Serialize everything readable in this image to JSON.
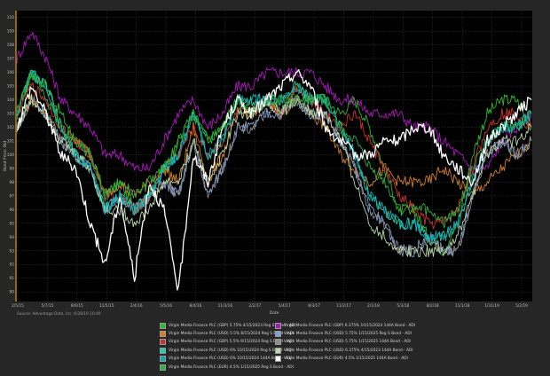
{
  "chart_data": {
    "type": "line",
    "title": "",
    "xlabel": "Date",
    "ylabel": "Bond Price: Bid",
    "source": "Source: Advantage Data, Inc. 6/28/19 10:40",
    "x_ticks": [
      "2/5/15",
      "5/7/15",
      "8/6/15",
      "11/5/15",
      "2/4/16",
      "5/5/16",
      "8/4/16",
      "11/3/16",
      "2/2/17",
      "5/4/17",
      "8/3/17",
      "11/2/17",
      "2/1/18",
      "5/3/18",
      "8/2/18",
      "11/1/18",
      "1/31/19",
      "5/2/19"
    ],
    "y_ticks": [
      90,
      91,
      92,
      93,
      94,
      95,
      96,
      97,
      98,
      99,
      100,
      101,
      102,
      103,
      104,
      105,
      106,
      107,
      108,
      109,
      110
    ],
    "ylim": [
      89.3,
      110.5
    ],
    "grid": true,
    "legend_position": "bottom",
    "colors": {
      "background": "#000000",
      "frame": "#262626",
      "grid": "#3a3a3a",
      "baseline": "#e0a020"
    },
    "series": [
      {
        "name": "Virgin Media Finance PLC (GBP) 5.75% 4/15/2023 Reg S Bond - ADI",
        "color": "#2db82d",
        "values": [
          103,
          106,
          105,
          103,
          101,
          100,
          97,
          98,
          96,
          97,
          99,
          101,
          103,
          101,
          102,
          104,
          103,
          104,
          103,
          105,
          104,
          104,
          103,
          104,
          102,
          99,
          96,
          96,
          94,
          93,
          95,
          100,
          103,
          104,
          104,
          102
        ]
      },
      {
        "name": "Virgin Media Finance PLC (GBP) 6.375% 10/15/2024 144A Bond - ADI",
        "color": "#a818b8",
        "values": [
          107,
          109,
          107,
          104,
          103,
          102,
          100,
          100,
          99,
          99,
          101,
          103,
          104,
          102,
          103,
          105,
          105,
          106,
          106,
          106,
          106,
          105,
          104,
          104,
          103,
          103,
          103,
          102,
          102,
          101,
          100,
          99,
          99,
          101,
          102,
          103
        ]
      },
      {
        "name": "Virgin Media Finance PLC (USD) 5.5% 8/15/2024 Reg S Bond - ADI",
        "color": "#d4801e",
        "values": [
          102,
          104,
          103,
          101,
          101,
          100,
          97,
          98,
          97,
          98,
          99,
          98,
          102,
          98,
          100,
          103,
          103,
          104,
          103,
          104,
          103,
          102,
          100,
          99,
          98,
          99,
          98,
          98,
          98,
          99,
          98,
          97,
          98,
          99,
          100,
          101
        ]
      },
      {
        "name": "Virgin Media Finance PLC (USD) 5.75% 1/15/2025 Reg S Bond - ADI",
        "color": "#7fa0d8",
        "values": [
          102,
          104,
          103,
          101,
          100,
          99,
          96,
          97,
          96,
          97,
          98,
          97,
          101,
          97,
          99,
          102,
          102,
          103,
          103,
          104,
          103,
          103,
          101,
          99,
          96,
          95,
          93,
          93,
          94,
          93,
          93,
          97,
          100,
          101,
          100,
          101
        ]
      },
      {
        "name": "Virgin Media Finance PLC (GBP) 5.5% 9/15/2024 Reg S Bond - ADI",
        "color": "#c8342c",
        "values": [
          103,
          105,
          104,
          102,
          101,
          100,
          97,
          97,
          96,
          97,
          99,
          100,
          102,
          100,
          101,
          103,
          103,
          104,
          103,
          105,
          104,
          103,
          102,
          103,
          101,
          99,
          97,
          96,
          95,
          95,
          96,
          99,
          102,
          103,
          103,
          102
        ]
      },
      {
        "name": "Virgin Media Finance PLC (USD) 5.75% 1/15/2025 144A Bond - ADI",
        "color": "#8c8c8c",
        "values": [
          102,
          104,
          103,
          101,
          100,
          99,
          96,
          97,
          96,
          97,
          98,
          97,
          101,
          97,
          99,
          102,
          102,
          103,
          103,
          104,
          103,
          103,
          101,
          99,
          96,
          95,
          93,
          93,
          94,
          93,
          93,
          97,
          100,
          101,
          100,
          101
        ]
      },
      {
        "name": "Virgin Media Finance PLC (USD) 6% 10/15/2024 Reg S Bond - ADI",
        "color": "#20d0a8",
        "values": [
          103,
          106,
          105,
          102,
          100,
          99,
          96,
          97,
          96,
          97,
          99,
          100,
          103,
          100,
          101,
          104,
          104,
          104,
          104,
          105,
          104,
          104,
          102,
          100,
          97,
          96,
          95,
          95,
          94,
          94,
          95,
          98,
          101,
          102,
          102,
          103
        ]
      },
      {
        "name": "Virgin Media Finance PLC (USD) 6.375% 4/15/2023 144A Bond - ADI",
        "color": "#b8d8a8",
        "values": [
          102,
          104,
          103,
          101,
          100,
          99,
          96,
          96,
          95,
          96,
          98,
          98,
          101,
          98,
          100,
          103,
          103,
          104,
          103,
          104,
          103,
          103,
          101,
          98,
          95,
          94,
          93,
          93,
          93,
          93,
          94,
          97,
          100,
          101,
          101,
          102
        ]
      },
      {
        "name": "Virgin Media Finance PLC (USD) 6% 10/15/2024 144A Bond - ADI",
        "color": "#10a8b0",
        "values": [
          103,
          106,
          105,
          102,
          100,
          99,
          96,
          97,
          96,
          97,
          99,
          100,
          103,
          100,
          101,
          104,
          104,
          104,
          104,
          105,
          104,
          104,
          102,
          100,
          97,
          96,
          95,
          95,
          94,
          94,
          95,
          98,
          101,
          102,
          102,
          103
        ]
      },
      {
        "name": "Virgin Media Finance PLC (EUR) 4.5% 1/15/2025 Reg S Bond - ADI",
        "color": "#2fb03f",
        "values": [
          103,
          106,
          104,
          102,
          101,
          100,
          97,
          98,
          97,
          98,
          99,
          101,
          103,
          101,
          102,
          104,
          103,
          104,
          104,
          104,
          104,
          104,
          102,
          101,
          99,
          98,
          96,
          96,
          96,
          95,
          96,
          99,
          101,
          102,
          102,
          103
        ]
      },
      {
        "name": "Virgin Media Finance PLC (EUR) 4.5% 1/15/2025 144A Bond - ADI",
        "color": "#ffffff",
        "values": [
          102,
          105,
          103,
          100,
          99,
          95,
          92,
          97,
          91,
          98,
          96,
          90,
          100,
          98,
          102,
          104,
          103,
          104,
          105,
          106,
          105,
          102,
          101,
          100,
          100,
          101,
          101,
          102,
          102,
          100,
          99,
          98,
          101,
          102,
          103,
          104
        ]
      }
    ]
  }
}
